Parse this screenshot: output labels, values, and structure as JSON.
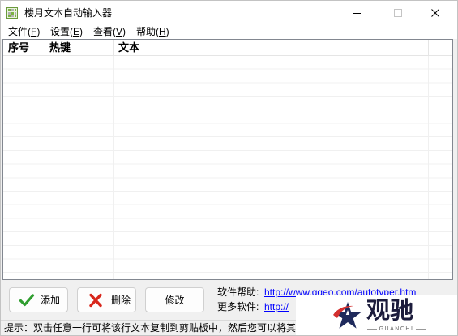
{
  "window": {
    "title": "楼月文本自动输入器",
    "icon": "app-grid-icon",
    "controls": {
      "minimize": {
        "icon": "minimize-icon",
        "enabled": true
      },
      "maximize": {
        "icon": "maximize-icon",
        "enabled": false
      },
      "close": {
        "icon": "close-icon",
        "enabled": true
      }
    }
  },
  "menu": {
    "items": [
      {
        "pre": "文件(",
        "key": "F",
        "post": ")"
      },
      {
        "pre": "设置(",
        "key": "E",
        "post": ")"
      },
      {
        "pre": "查看(",
        "key": "V",
        "post": ")"
      },
      {
        "pre": "帮助(",
        "key": "H",
        "post": ")"
      }
    ]
  },
  "table": {
    "columns": [
      "序号",
      "热键",
      "文本"
    ]
  },
  "buttons": {
    "add": {
      "label": "添加",
      "icon": "check-icon"
    },
    "delete": {
      "label": "删除",
      "icon": "x-icon"
    },
    "edit": {
      "label": "修改"
    }
  },
  "links": {
    "help_label": "软件帮助:",
    "help_url": "http://www.ggeo.com/autotyper.htm",
    "more_label": "更多软件:",
    "more_url": "http://"
  },
  "status": {
    "text": "提示：双击任意一行可将该行文本复制到剪贴板中，然后您可以将其"
  },
  "watermark": {
    "logo": "star-logo",
    "name": "观驰",
    "sub": "GUANCHI"
  },
  "colors": {
    "titlebar_bg": "#ffffff",
    "client_bg": "#f0f0f0",
    "table_border": "#828790",
    "grid_line": "#f0f0f0",
    "link": "#0000ff",
    "check": "#2f9e2f",
    "x_mark": "#d8261b",
    "watermark_text": "#1c1c3c"
  }
}
